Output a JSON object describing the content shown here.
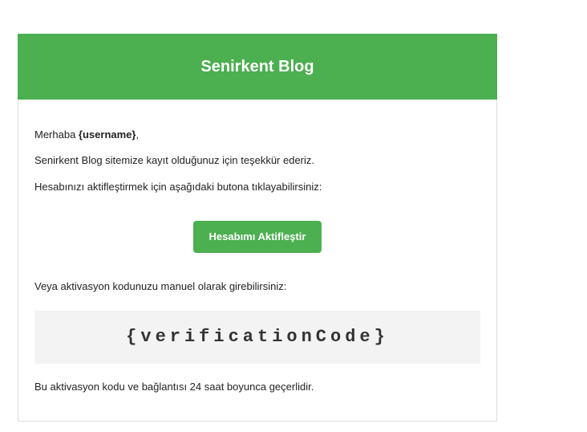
{
  "header": {
    "title": "Senirkent Blog"
  },
  "body": {
    "greeting_prefix": "Merhaba ",
    "greeting_username": "{username}",
    "greeting_suffix": ",",
    "thanks": "Senirkent Blog sitemize kayıt olduğunuz için teşekkür ederiz.",
    "instruction": "Hesabınızı aktifleştirmek için aşağıdaki butona tıklayabilirsiniz:",
    "activate_button": "Hesabımı Aktifleştir",
    "manual_text": "Veya aktivasyon kodunuzu manuel olarak girebilirsiniz:",
    "verification_code": "{verificationCode}",
    "validity": "Bu aktivasyon kodu ve bağlantısı 24 saat boyunca geçerlidir."
  },
  "colors": {
    "accent": "#4caf50",
    "code_box_bg": "#f3f3f3"
  }
}
